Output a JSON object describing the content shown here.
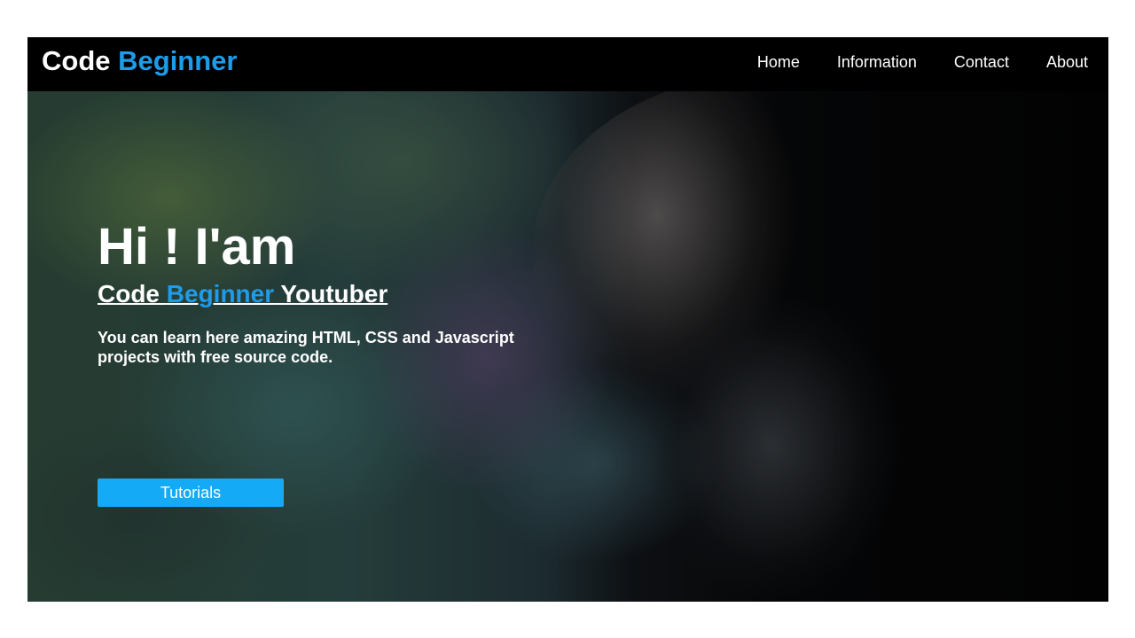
{
  "brand": {
    "first": "Code",
    "second": "Beginner",
    "accent_color": "#1e9be9"
  },
  "nav": {
    "items": [
      {
        "label": "Home"
      },
      {
        "label": "Information"
      },
      {
        "label": "Contact"
      },
      {
        "label": "About"
      }
    ]
  },
  "hero": {
    "heading": "Hi ! I'am",
    "subheading_part1": "Code ",
    "subheading_accent": "Beginner",
    "subheading_part2": " Youtuber",
    "description": "You can learn here amazing HTML, CSS and Javascript projects with free source code.",
    "button_label": "Tutorials",
    "button_color": "#14aaf5"
  }
}
